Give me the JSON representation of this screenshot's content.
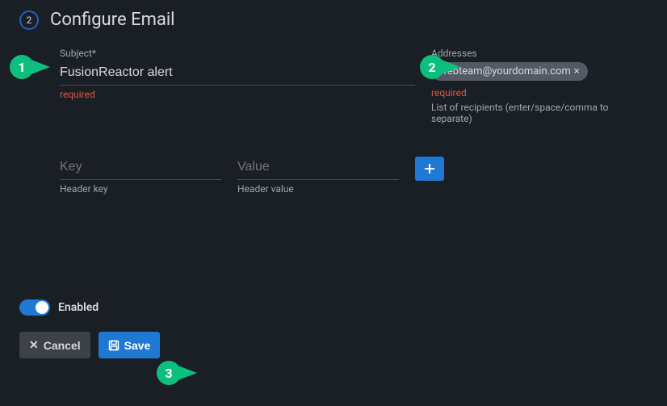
{
  "header": {
    "step_number": "2",
    "title": "Configure Email"
  },
  "subject": {
    "label": "Subject*",
    "value": "FusionReactor alert",
    "validation": "required"
  },
  "addresses": {
    "label": "Addresses",
    "chip_text": "webteam@yourdomain.com",
    "validation": "required",
    "helper": "List of recipients (enter/space/comma to separate)"
  },
  "headers": {
    "key_label": "Key",
    "key_helper": "Header key",
    "value_label": "Value",
    "value_helper": "Header value"
  },
  "enabled": {
    "label": "Enabled"
  },
  "buttons": {
    "cancel": "Cancel",
    "save": "Save"
  },
  "annotations": {
    "a1": "1",
    "a2": "2",
    "a3": "3"
  }
}
